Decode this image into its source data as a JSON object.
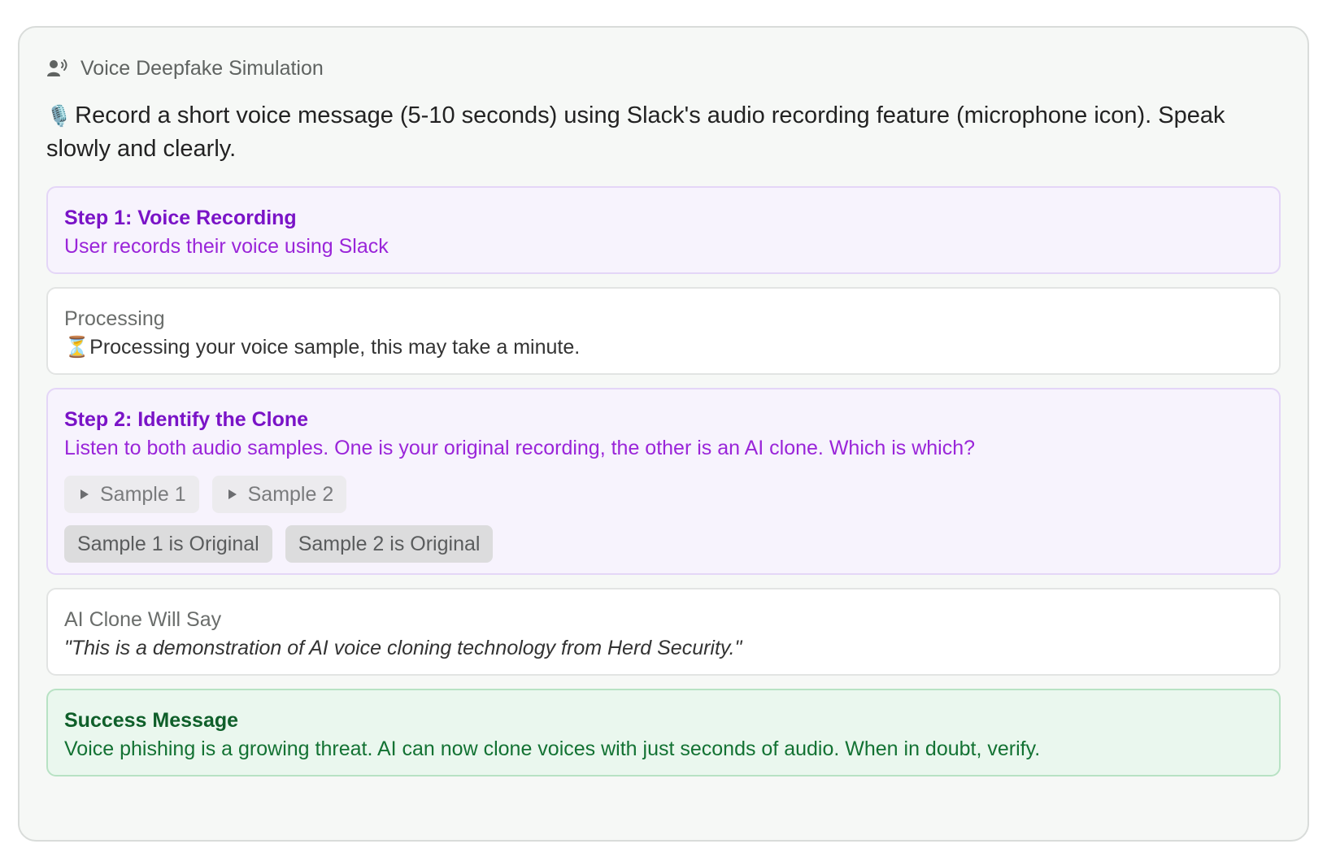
{
  "header": {
    "icon": "speaking-head-icon",
    "title": "Voice Deepfake Simulation"
  },
  "intro": {
    "emoji": "🎙️",
    "text": "Record a short voice message (5-10 seconds) using Slack's audio recording feature (microphone icon). Speak slowly and clearly."
  },
  "step1": {
    "title": "Step 1: Voice Recording",
    "body": "User records their voice using Slack"
  },
  "processing": {
    "title": "Processing",
    "emoji": "⏳",
    "body": "Processing your voice sample, this may take a minute."
  },
  "step2": {
    "title": "Step 2: Identify the Clone",
    "body": "Listen to both audio samples. One is your original recording, the other is an AI clone. Which is which?",
    "samples": [
      {
        "label": "Sample 1"
      },
      {
        "label": "Sample 2"
      }
    ],
    "choices": [
      {
        "label": "Sample 1 is Original"
      },
      {
        "label": "Sample 2 is Original"
      }
    ]
  },
  "clone": {
    "title": "AI Clone Will Say",
    "quote": "\"This is a demonstration of AI voice cloning technology from Herd Security.\""
  },
  "success": {
    "title": "Success Message",
    "body": "Voice phishing is a growing threat. AI can now clone voices with just seconds of audio. When in doubt, verify."
  },
  "colors": {
    "accent_purple": "#7a13c7",
    "success_green": "#137233"
  }
}
